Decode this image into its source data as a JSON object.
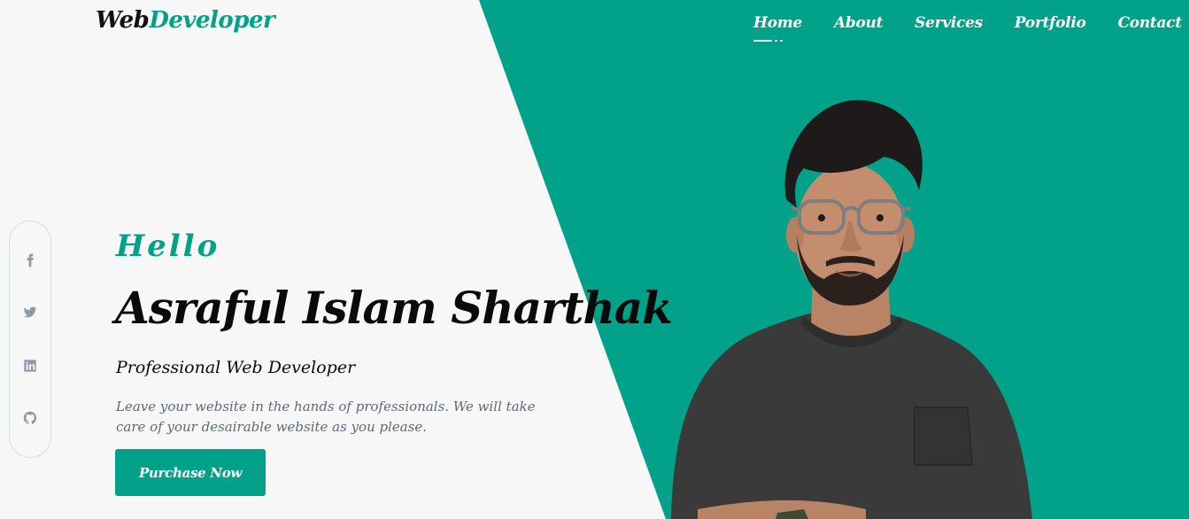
{
  "logo": {
    "part1": "Web",
    "part2": "Developer"
  },
  "nav": {
    "items": [
      {
        "label": "Home",
        "active": true
      },
      {
        "label": "About"
      },
      {
        "label": "Services"
      },
      {
        "label": "Portfolio"
      },
      {
        "label": "Contact"
      }
    ]
  },
  "social": {
    "icons": [
      "facebook-icon",
      "twitter-icon",
      "linkedin-icon",
      "github-icon"
    ]
  },
  "hero": {
    "greeting": "Hello",
    "name": "Asraful Islam Sharthak",
    "role": "Professional Web Developer",
    "description": "Leave your website in the hands of professionals. We will take care of your desairable website as you please.",
    "cta_label": "Purchase Now"
  },
  "colors": {
    "accent": "#02a189",
    "background": "#f7f7f7",
    "text": "#0a0a0a",
    "muted": "#5a6a7a"
  }
}
